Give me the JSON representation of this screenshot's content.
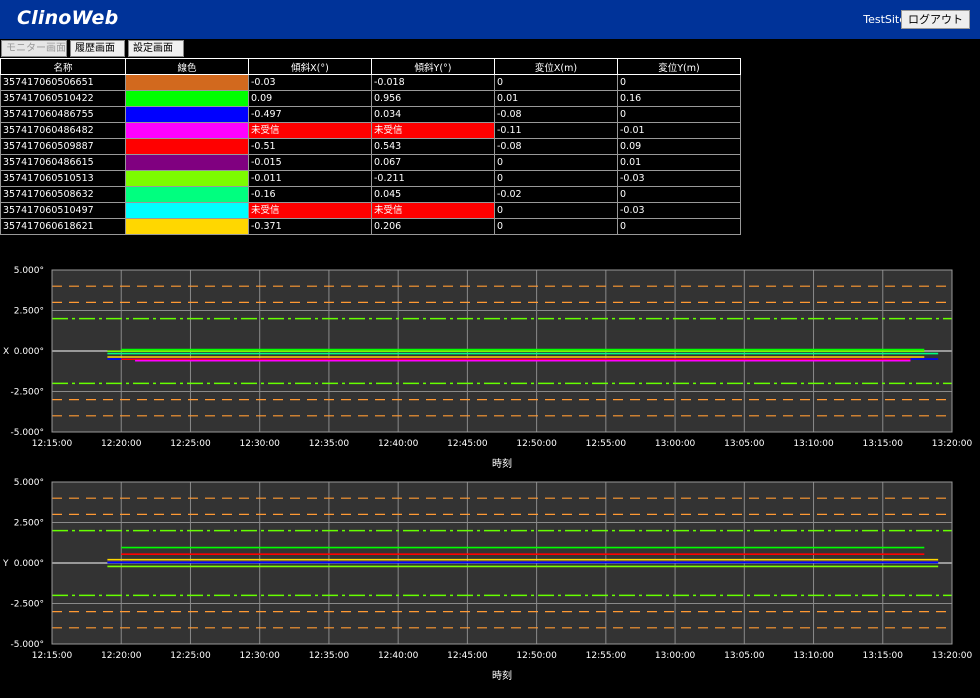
{
  "header": {
    "logo": "ClinoWeb",
    "site": "TestSite",
    "logout_label": "ログアウト"
  },
  "tabs": [
    {
      "label": "モニター画面",
      "active": true
    },
    {
      "label": "履歴画面",
      "active": false
    },
    {
      "label": "設定画面",
      "active": false
    }
  ],
  "table": {
    "columns": [
      "名称",
      "線色",
      "傾斜X(°)",
      "傾斜Y(°)",
      "変位X(m)",
      "変位Y(m)"
    ],
    "unreceived_color": "#ff0000",
    "rows": [
      {
        "name": "357417060506651",
        "color": "#d2691e",
        "tiltx": "-0.03",
        "tilty": "-0.018",
        "dispx": "0",
        "dispy": "0"
      },
      {
        "name": "357417060510422",
        "color": "#00ff00",
        "tiltx": "0.09",
        "tilty": "0.956",
        "dispx": "0.01",
        "dispy": "0.16"
      },
      {
        "name": "357417060486755",
        "color": "#0000ff",
        "tiltx": "-0.497",
        "tilty": "0.034",
        "dispx": "-0.08",
        "dispy": "0"
      },
      {
        "name": "357417060486482",
        "color": "#ff00ff",
        "tiltx": "未受信",
        "tilty": "未受信",
        "dispx": "-0.11",
        "dispy": "-0.01"
      },
      {
        "name": "357417060509887",
        "color": "#ff0000",
        "tiltx": "-0.51",
        "tilty": "0.543",
        "dispx": "-0.08",
        "dispy": "0.09"
      },
      {
        "name": "357417060486615",
        "color": "#800080",
        "tiltx": "-0.015",
        "tilty": "0.067",
        "dispx": "0",
        "dispy": "0.01"
      },
      {
        "name": "357417060510513",
        "color": "#7cfc00",
        "tiltx": "-0.011",
        "tilty": "-0.211",
        "dispx": "0",
        "dispy": "-0.03"
      },
      {
        "name": "357417060508632",
        "color": "#00ff7f",
        "tiltx": "-0.16",
        "tilty": "0.045",
        "dispx": "-0.02",
        "dispy": "0"
      },
      {
        "name": "357417060510497",
        "color": "#00ffff",
        "tiltx": "未受信",
        "tilty": "未受信",
        "dispx": "0",
        "dispy": "-0.03"
      },
      {
        "name": "357417060618621",
        "color": "#ffd700",
        "tiltx": "-0.371",
        "tilty": "0.206",
        "dispx": "0",
        "dispy": "0"
      }
    ]
  },
  "chart_data": [
    {
      "type": "line",
      "ylabel": "X",
      "xlabel": "時刻",
      "ylim": [
        -5,
        5
      ],
      "y_ticks": [
        "5.000°",
        "2.500°",
        "0.000°",
        "-2.500°",
        "-5.000°"
      ],
      "y_tick_values": [
        5,
        2.5,
        0,
        -2.5,
        -5
      ],
      "x_ticks": [
        "12:15:00",
        "12:20:00",
        "12:25:00",
        "12:30:00",
        "12:35:00",
        "12:40:00",
        "12:45:00",
        "12:50:00",
        "12:55:00",
        "13:00:00",
        "13:05:00",
        "13:10:00",
        "13:15:00",
        "13:20:00"
      ],
      "xlim": [
        "12:15:00",
        "13:20:00"
      ],
      "grid": true,
      "colors": {
        "plot_bg": "#333333",
        "grid": "#8a8a8a",
        "warn": "#ff9933",
        "limit": "#66ff00",
        "zero": "#ffffff"
      },
      "thresholds": [
        {
          "y": 4.0,
          "kind": "warn"
        },
        {
          "y": 3.0,
          "kind": "warn"
        },
        {
          "y": 2.0,
          "kind": "limit"
        },
        {
          "y": -2.0,
          "kind": "limit"
        },
        {
          "y": -3.0,
          "kind": "warn"
        },
        {
          "y": -4.0,
          "kind": "warn"
        }
      ],
      "series": [
        {
          "color": "#00ff00",
          "x": [
            "12:20:00",
            "13:18:00"
          ],
          "y": [
            0.09,
            0.09
          ]
        },
        {
          "color": "#7cfc00",
          "x": [
            "12:19:00",
            "13:18:00"
          ],
          "y": [
            -0.011,
            -0.011
          ]
        },
        {
          "color": "#00ff7f",
          "x": [
            "12:19:00",
            "13:19:00"
          ],
          "y": [
            -0.16,
            -0.16
          ]
        },
        {
          "color": "#ffd700",
          "x": [
            "12:19:00",
            "13:18:00"
          ],
          "y": [
            -0.371,
            -0.371
          ]
        },
        {
          "color": "#0000ff",
          "x": [
            "12:19:00",
            "13:19:00"
          ],
          "y": [
            -0.497,
            -0.497
          ]
        },
        {
          "color": "#ff0000",
          "x": [
            "12:20:00",
            "13:17:00"
          ],
          "y": [
            -0.51,
            -0.51
          ]
        },
        {
          "color": "#ff00ff",
          "x": [
            "12:21:00",
            "13:17:00"
          ],
          "y": [
            -0.6,
            -0.6
          ]
        }
      ]
    },
    {
      "type": "line",
      "ylabel": "Y",
      "xlabel": "時刻",
      "ylim": [
        -5,
        5
      ],
      "y_ticks": [
        "5.000°",
        "2.500°",
        "0.000°",
        "-2.500°",
        "-5.000°"
      ],
      "y_tick_values": [
        5,
        2.5,
        0,
        -2.5,
        -5
      ],
      "x_ticks": [
        "12:15:00",
        "12:20:00",
        "12:25:00",
        "12:30:00",
        "12:35:00",
        "12:40:00",
        "12:45:00",
        "12:50:00",
        "12:55:00",
        "13:00:00",
        "13:05:00",
        "13:10:00",
        "13:15:00",
        "13:20:00"
      ],
      "xlim": [
        "12:15:00",
        "13:20:00"
      ],
      "grid": true,
      "colors": {
        "plot_bg": "#333333",
        "grid": "#8a8a8a",
        "warn": "#ff9933",
        "limit": "#66ff00",
        "zero": "#ffffff"
      },
      "thresholds": [
        {
          "y": 4.0,
          "kind": "warn"
        },
        {
          "y": 3.0,
          "kind": "warn"
        },
        {
          "y": 2.0,
          "kind": "limit"
        },
        {
          "y": -2.0,
          "kind": "limit"
        },
        {
          "y": -3.0,
          "kind": "warn"
        },
        {
          "y": -4.0,
          "kind": "warn"
        }
      ],
      "series": [
        {
          "color": "#00ff00",
          "x": [
            "12:20:00",
            "13:18:00"
          ],
          "y": [
            0.956,
            0.956
          ]
        },
        {
          "color": "#ff0000",
          "x": [
            "12:20:00",
            "13:18:00"
          ],
          "y": [
            0.543,
            0.543
          ]
        },
        {
          "color": "#ffd700",
          "x": [
            "12:19:00",
            "13:19:00"
          ],
          "y": [
            0.206,
            0.206
          ]
        },
        {
          "color": "#800080",
          "x": [
            "12:19:00",
            "13:19:00"
          ],
          "y": [
            0.067,
            0.067
          ]
        },
        {
          "color": "#00ff7f",
          "x": [
            "12:19:00",
            "13:19:00"
          ],
          "y": [
            0.045,
            0.045
          ]
        },
        {
          "color": "#0000ff",
          "x": [
            "12:19:00",
            "13:19:00"
          ],
          "y": [
            0.034,
            0.034
          ]
        },
        {
          "color": "#7cfc00",
          "x": [
            "12:19:00",
            "13:19:00"
          ],
          "y": [
            -0.211,
            -0.211
          ]
        }
      ]
    }
  ]
}
